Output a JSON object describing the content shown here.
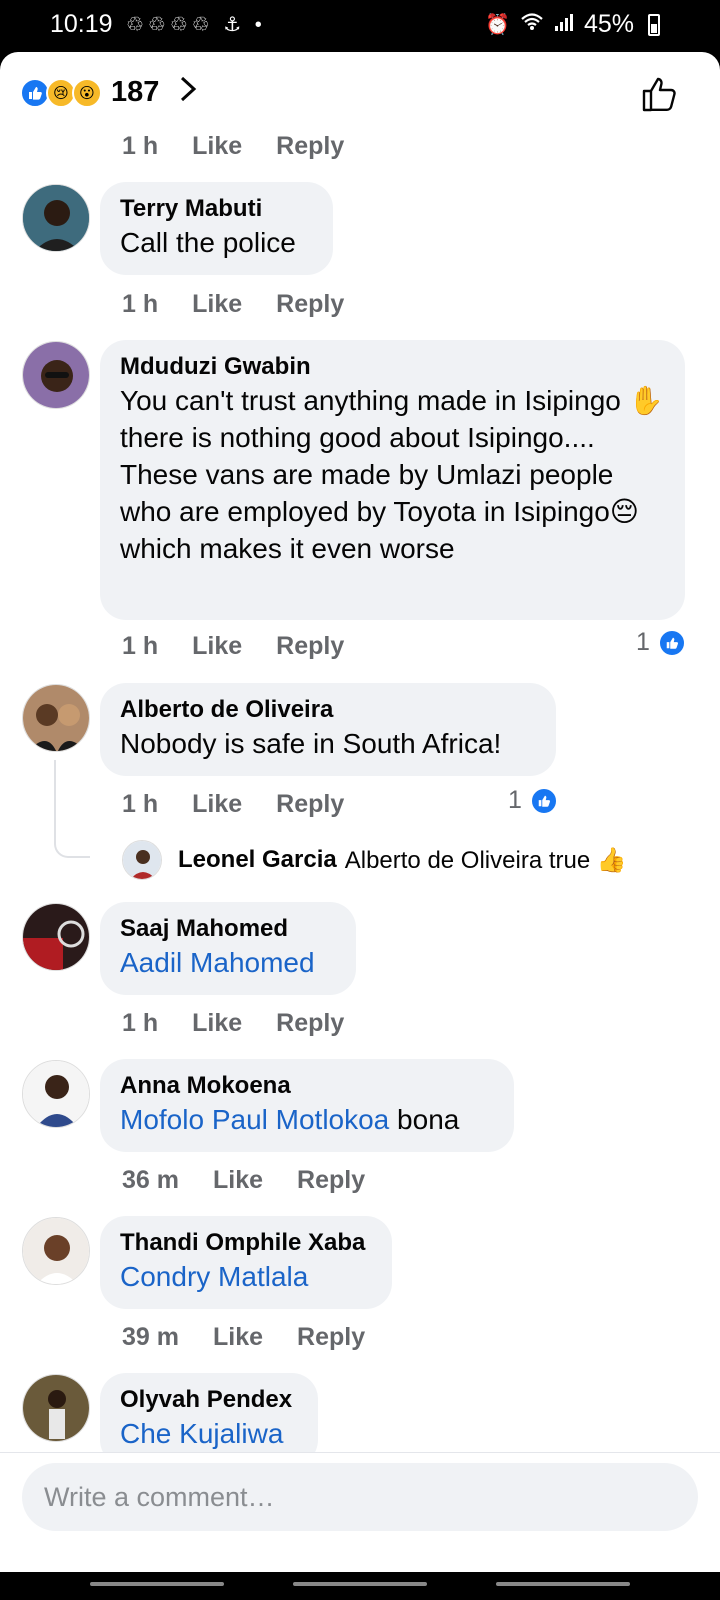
{
  "status_bar": {
    "time": "10:19",
    "notification_icons": "♲♲♲♲ ⚓ •",
    "alarm_icon": "alarm-icon",
    "wifi_icon": "wifi-icon",
    "signal_icon": "signal-icon",
    "battery": "45%"
  },
  "reactions": {
    "count": "187",
    "icons": [
      "like-reaction",
      "sad-reaction",
      "wow-reaction"
    ]
  },
  "comments": [
    {
      "author": "",
      "text": "",
      "time": "1 h",
      "like_label": "Like",
      "reply_label": "Reply"
    },
    {
      "author": "Terry Mabuti",
      "text": "Call the police",
      "time": "1 h",
      "like_label": "Like",
      "reply_label": "Reply"
    },
    {
      "author": "Mduduzi Gwabin",
      "text": "You can't trust anything made in Isipingo ✋ there is nothing good about Isipingo.... These vans are made by Umlazi people who are employed by Toyota in Isipingo😔which makes it even worse",
      "time": "1 h",
      "like_label": "Like",
      "reply_label": "Reply",
      "likes": "1"
    },
    {
      "author": "Alberto de Oliveira",
      "text": "Nobody is safe in South Africa!",
      "time": "1 h",
      "like_label": "Like",
      "reply_label": "Reply",
      "likes": "1",
      "reply": {
        "author": "Leonel Garcia",
        "text": "Alberto de Oliveira  true 👍"
      }
    },
    {
      "author": "Saaj Mahomed",
      "mention": "Aadil Mahomed",
      "text": "",
      "time": "1 h",
      "like_label": "Like",
      "reply_label": "Reply"
    },
    {
      "author": "Anna Mokoena",
      "mention": "Mofolo Paul Motlokoa",
      "text": " bona",
      "time": "36 m",
      "like_label": "Like",
      "reply_label": "Reply"
    },
    {
      "author": "Thandi Omphile Xaba",
      "mention": "Condry Matlala",
      "text": "",
      "time": "39 m",
      "like_label": "Like",
      "reply_label": "Reply"
    },
    {
      "author": "Olyvah Pendex",
      "mention": "Che Kujaliwa",
      "text": ""
    }
  ],
  "composer": {
    "placeholder": "Write a comment…"
  },
  "colors": {
    "accent": "#1877f2",
    "mention": "#1a64c8",
    "bubble": "#f0f2f5",
    "meta": "#65676b"
  }
}
